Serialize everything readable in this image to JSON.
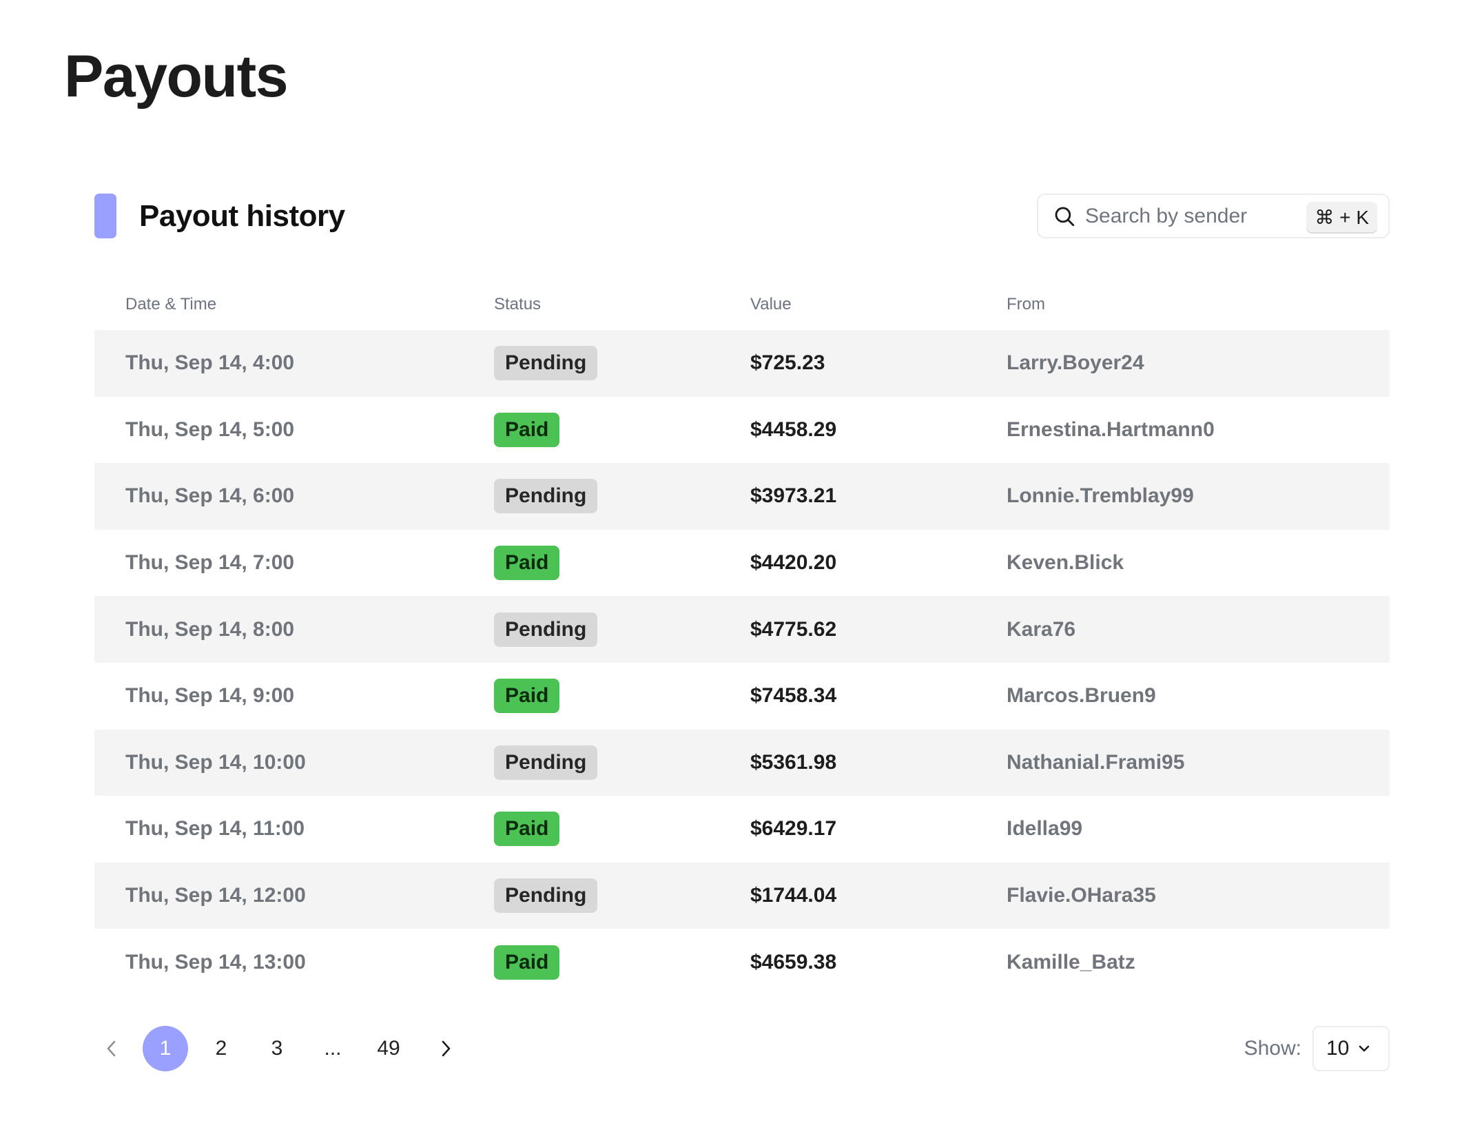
{
  "page": {
    "title": "Payouts"
  },
  "section": {
    "title": "Payout history",
    "accent_color": "#9aa0ff"
  },
  "search": {
    "placeholder": "Search by sender",
    "shortcut": "⌘ + K",
    "icon": "search-icon"
  },
  "table": {
    "columns": [
      "Date & Time",
      "Status",
      "Value",
      "From"
    ],
    "rows": [
      {
        "date": "Thu, Sep 14, 4:00",
        "status": "Pending",
        "value": "$725.23",
        "from": "Larry.Boyer24"
      },
      {
        "date": "Thu, Sep 14, 5:00",
        "status": "Paid",
        "value": "$4458.29",
        "from": "Ernestina.Hartmann0"
      },
      {
        "date": "Thu, Sep 14, 6:00",
        "status": "Pending",
        "value": "$3973.21",
        "from": "Lonnie.Tremblay99"
      },
      {
        "date": "Thu, Sep 14, 7:00",
        "status": "Paid",
        "value": "$4420.20",
        "from": "Keven.Blick"
      },
      {
        "date": "Thu, Sep 14, 8:00",
        "status": "Pending",
        "value": "$4775.62",
        "from": "Kara76"
      },
      {
        "date": "Thu, Sep 14, 9:00",
        "status": "Paid",
        "value": "$7458.34",
        "from": "Marcos.Bruen9"
      },
      {
        "date": "Thu, Sep 14, 10:00",
        "status": "Pending",
        "value": "$5361.98",
        "from": "Nathanial.Frami95"
      },
      {
        "date": "Thu, Sep 14, 11:00",
        "status": "Paid",
        "value": "$6429.17",
        "from": "Idella99"
      },
      {
        "date": "Thu, Sep 14, 12:00",
        "status": "Pending",
        "value": "$1744.04",
        "from": "Flavie.OHara35"
      },
      {
        "date": "Thu, Sep 14, 13:00",
        "status": "Paid",
        "value": "$4659.38",
        "from": "Kamille_Batz"
      }
    ]
  },
  "pagination": {
    "pages": [
      "1",
      "2",
      "3",
      "...",
      "49"
    ],
    "current": "1",
    "active_color": "#9aa0ff",
    "prev_icon": "chevron-left-icon",
    "next_icon": "chevron-right-icon"
  },
  "page_size": {
    "label": "Show:",
    "value": "10",
    "icon": "chevron-down-icon"
  }
}
